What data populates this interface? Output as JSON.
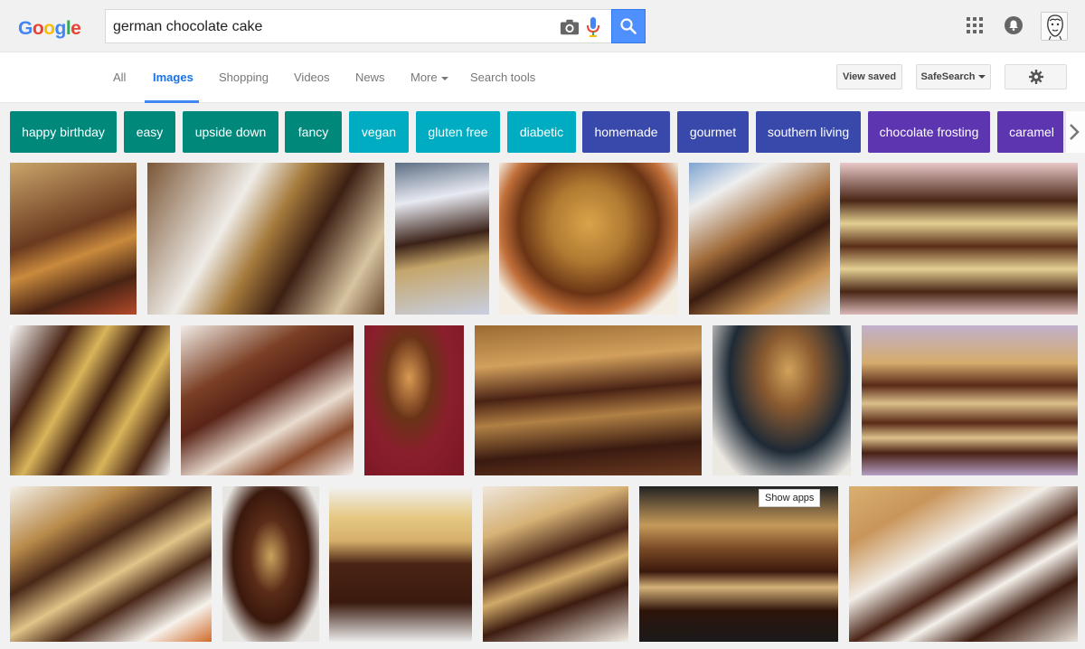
{
  "logo": {
    "letters": [
      "G",
      "o",
      "o",
      "g",
      "l",
      "e"
    ]
  },
  "search": {
    "query": "german chocolate cake"
  },
  "tabs": [
    {
      "label": "All"
    },
    {
      "label": "Images"
    },
    {
      "label": "Shopping"
    },
    {
      "label": "Videos"
    },
    {
      "label": "News"
    },
    {
      "label": "More"
    },
    {
      "label": "Search tools"
    }
  ],
  "actions": {
    "view_saved": "View saved",
    "safesearch": "SafeSearch"
  },
  "chips": [
    {
      "label": "happy birthday",
      "color": "#00897b"
    },
    {
      "label": "easy",
      "color": "#00897b"
    },
    {
      "label": "upside down",
      "color": "#00897b"
    },
    {
      "label": "fancy",
      "color": "#00897b"
    },
    {
      "label": "vegan",
      "color": "#00acc1"
    },
    {
      "label": "gluten free",
      "color": "#00acc1"
    },
    {
      "label": "diabetic",
      "color": "#00acc1"
    },
    {
      "label": "homemade",
      "color": "#3949ab"
    },
    {
      "label": "gourmet",
      "color": "#3949ab"
    },
    {
      "label": "southern living",
      "color": "#3949ab"
    },
    {
      "label": "chocolate frosting",
      "color": "#5e35b1"
    },
    {
      "label": "caramel",
      "color": "#5e35b1"
    }
  ],
  "tooltip": "Show apps",
  "colors": {
    "search_blue": "#4d90fe",
    "active_tab": "#1a73e8",
    "underline": "#4285f4"
  }
}
